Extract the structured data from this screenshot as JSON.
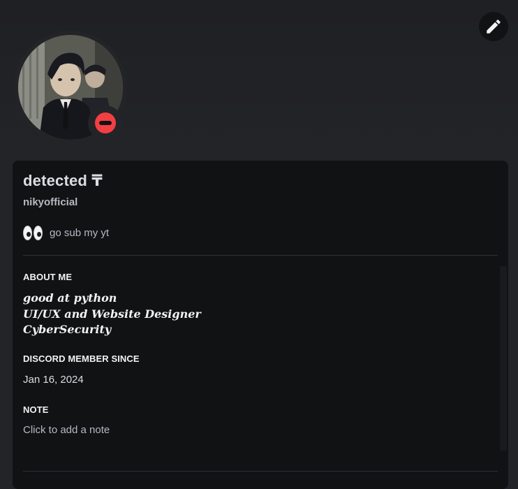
{
  "profile": {
    "display_name": "detected ₸",
    "username": "nikyofficial",
    "custom_status": {
      "emoji": "eyes-emoji",
      "text": "go sub my yt"
    },
    "presence": "do-not-disturb",
    "presence_color": "#f23f43"
  },
  "actions": {
    "edit_icon": "pencil-icon"
  },
  "sections": {
    "about_title": "ABOUT ME",
    "about_lines": [
      "good at python",
      "UI/UX and Website Designer",
      "CyberSecurity"
    ],
    "member_since_title": "DISCORD MEMBER SINCE",
    "member_since_date": "Jan 16, 2024",
    "note_title": "NOTE",
    "note_placeholder": "Click to add a note"
  },
  "colors": {
    "background": "#232428",
    "card": "#111214",
    "text_primary": "#dbdee1",
    "text_muted": "#b5bac1"
  }
}
